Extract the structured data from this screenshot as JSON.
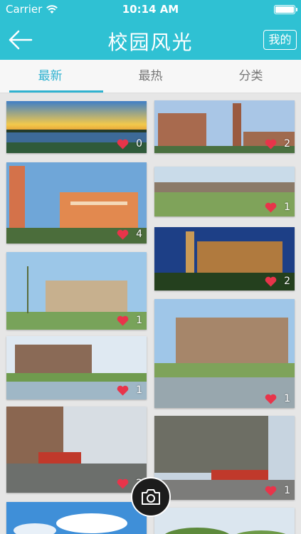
{
  "status": {
    "carrier": "Carrier",
    "time": "10:14 AM"
  },
  "nav": {
    "title": "校园风光",
    "mine_label": "我的"
  },
  "tabs": [
    {
      "label": "最新",
      "active": true
    },
    {
      "label": "最热",
      "active": false
    },
    {
      "label": "分类",
      "active": false
    }
  ],
  "photos": [
    {
      "likes": "0"
    },
    {
      "likes": "2"
    },
    {
      "likes": "4"
    },
    {
      "likes": "1"
    },
    {
      "likes": "2"
    },
    {
      "likes": "1"
    },
    {
      "likes": "1"
    },
    {
      "likes": "1"
    },
    {
      "likes": "2"
    },
    {
      "likes": "1"
    },
    {
      "likes": ""
    },
    {
      "likes": ""
    }
  ],
  "icons": [
    "wifi-icon",
    "battery-icon",
    "back-arrow-icon",
    "heart-icon",
    "camera-icon"
  ],
  "colors": {
    "accent": "#2fc1d3",
    "tab_active": "#2fb2d0",
    "heart": "#e8344a"
  }
}
